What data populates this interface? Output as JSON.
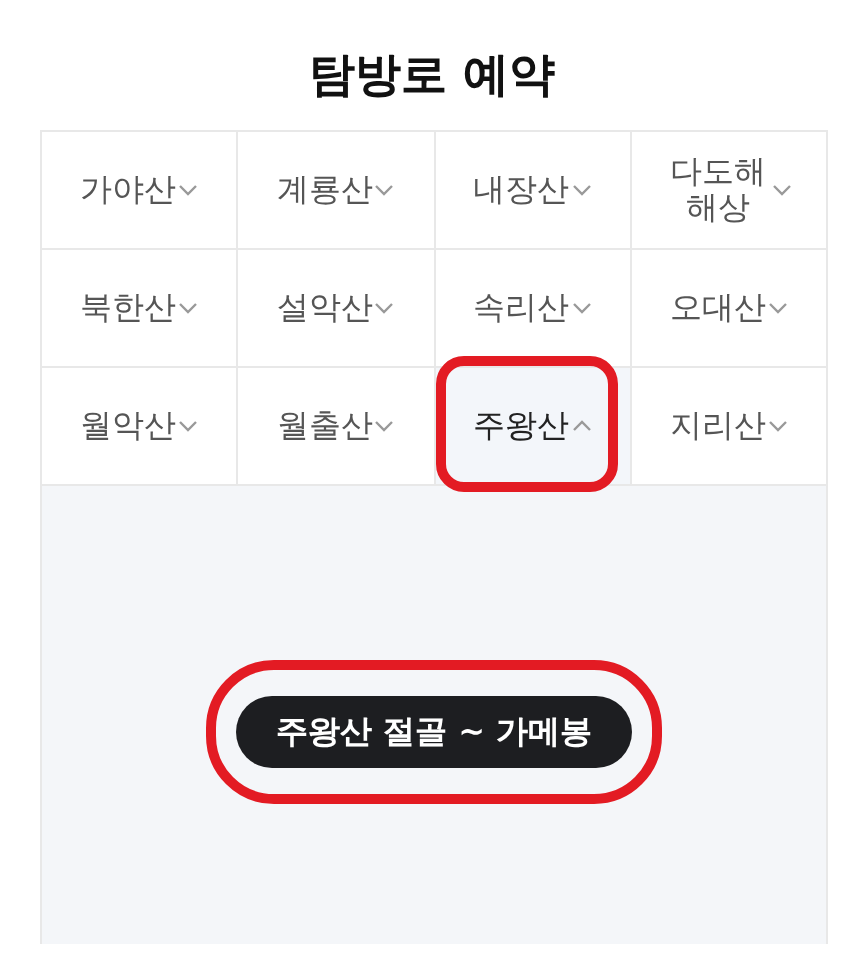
{
  "title": "탐방로 예약",
  "mountains": [
    {
      "label": "가야산",
      "selected": false,
      "highlighted": false
    },
    {
      "label": "계룡산",
      "selected": false,
      "highlighted": false
    },
    {
      "label": "내장산",
      "selected": false,
      "highlighted": false
    },
    {
      "label": "다도해해상",
      "selected": false,
      "highlighted": false
    },
    {
      "label": "북한산",
      "selected": false,
      "highlighted": false
    },
    {
      "label": "설악산",
      "selected": false,
      "highlighted": false
    },
    {
      "label": "속리산",
      "selected": false,
      "highlighted": false
    },
    {
      "label": "오대산",
      "selected": false,
      "highlighted": false
    },
    {
      "label": "월악산",
      "selected": false,
      "highlighted": false
    },
    {
      "label": "월출산",
      "selected": false,
      "highlighted": false
    },
    {
      "label": "주왕산",
      "selected": true,
      "highlighted": true
    },
    {
      "label": "지리산",
      "selected": false,
      "highlighted": false
    }
  ],
  "routes": [
    {
      "label": "주왕산 절골 ~ 가메봉",
      "highlighted": true
    }
  ]
}
